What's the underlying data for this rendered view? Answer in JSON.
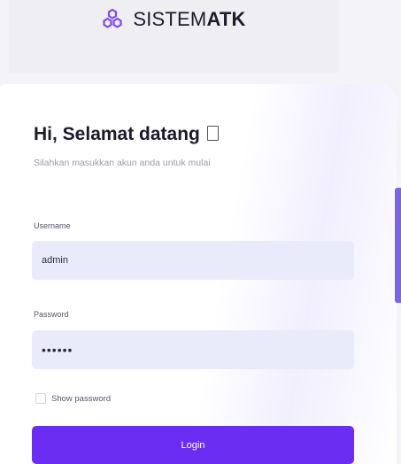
{
  "header": {
    "brand_prefix": "SISTEM",
    "brand_suffix": "ATK",
    "logo_icon": "hexagon-cluster-icon",
    "logo_color": "#7b4ce8"
  },
  "form": {
    "title": "Hi, Selamat datang",
    "subtitle": "Silahkan masukkan akun anda untuk mulai",
    "username_label": "Username",
    "username_value": "admin",
    "password_label": "Password",
    "password_value": "••••••",
    "show_password_label": "Show password",
    "show_password_checked": false,
    "login_label": "Login"
  },
  "colors": {
    "accent": "#6c2df2",
    "input_bg": "#e9ebfb"
  }
}
